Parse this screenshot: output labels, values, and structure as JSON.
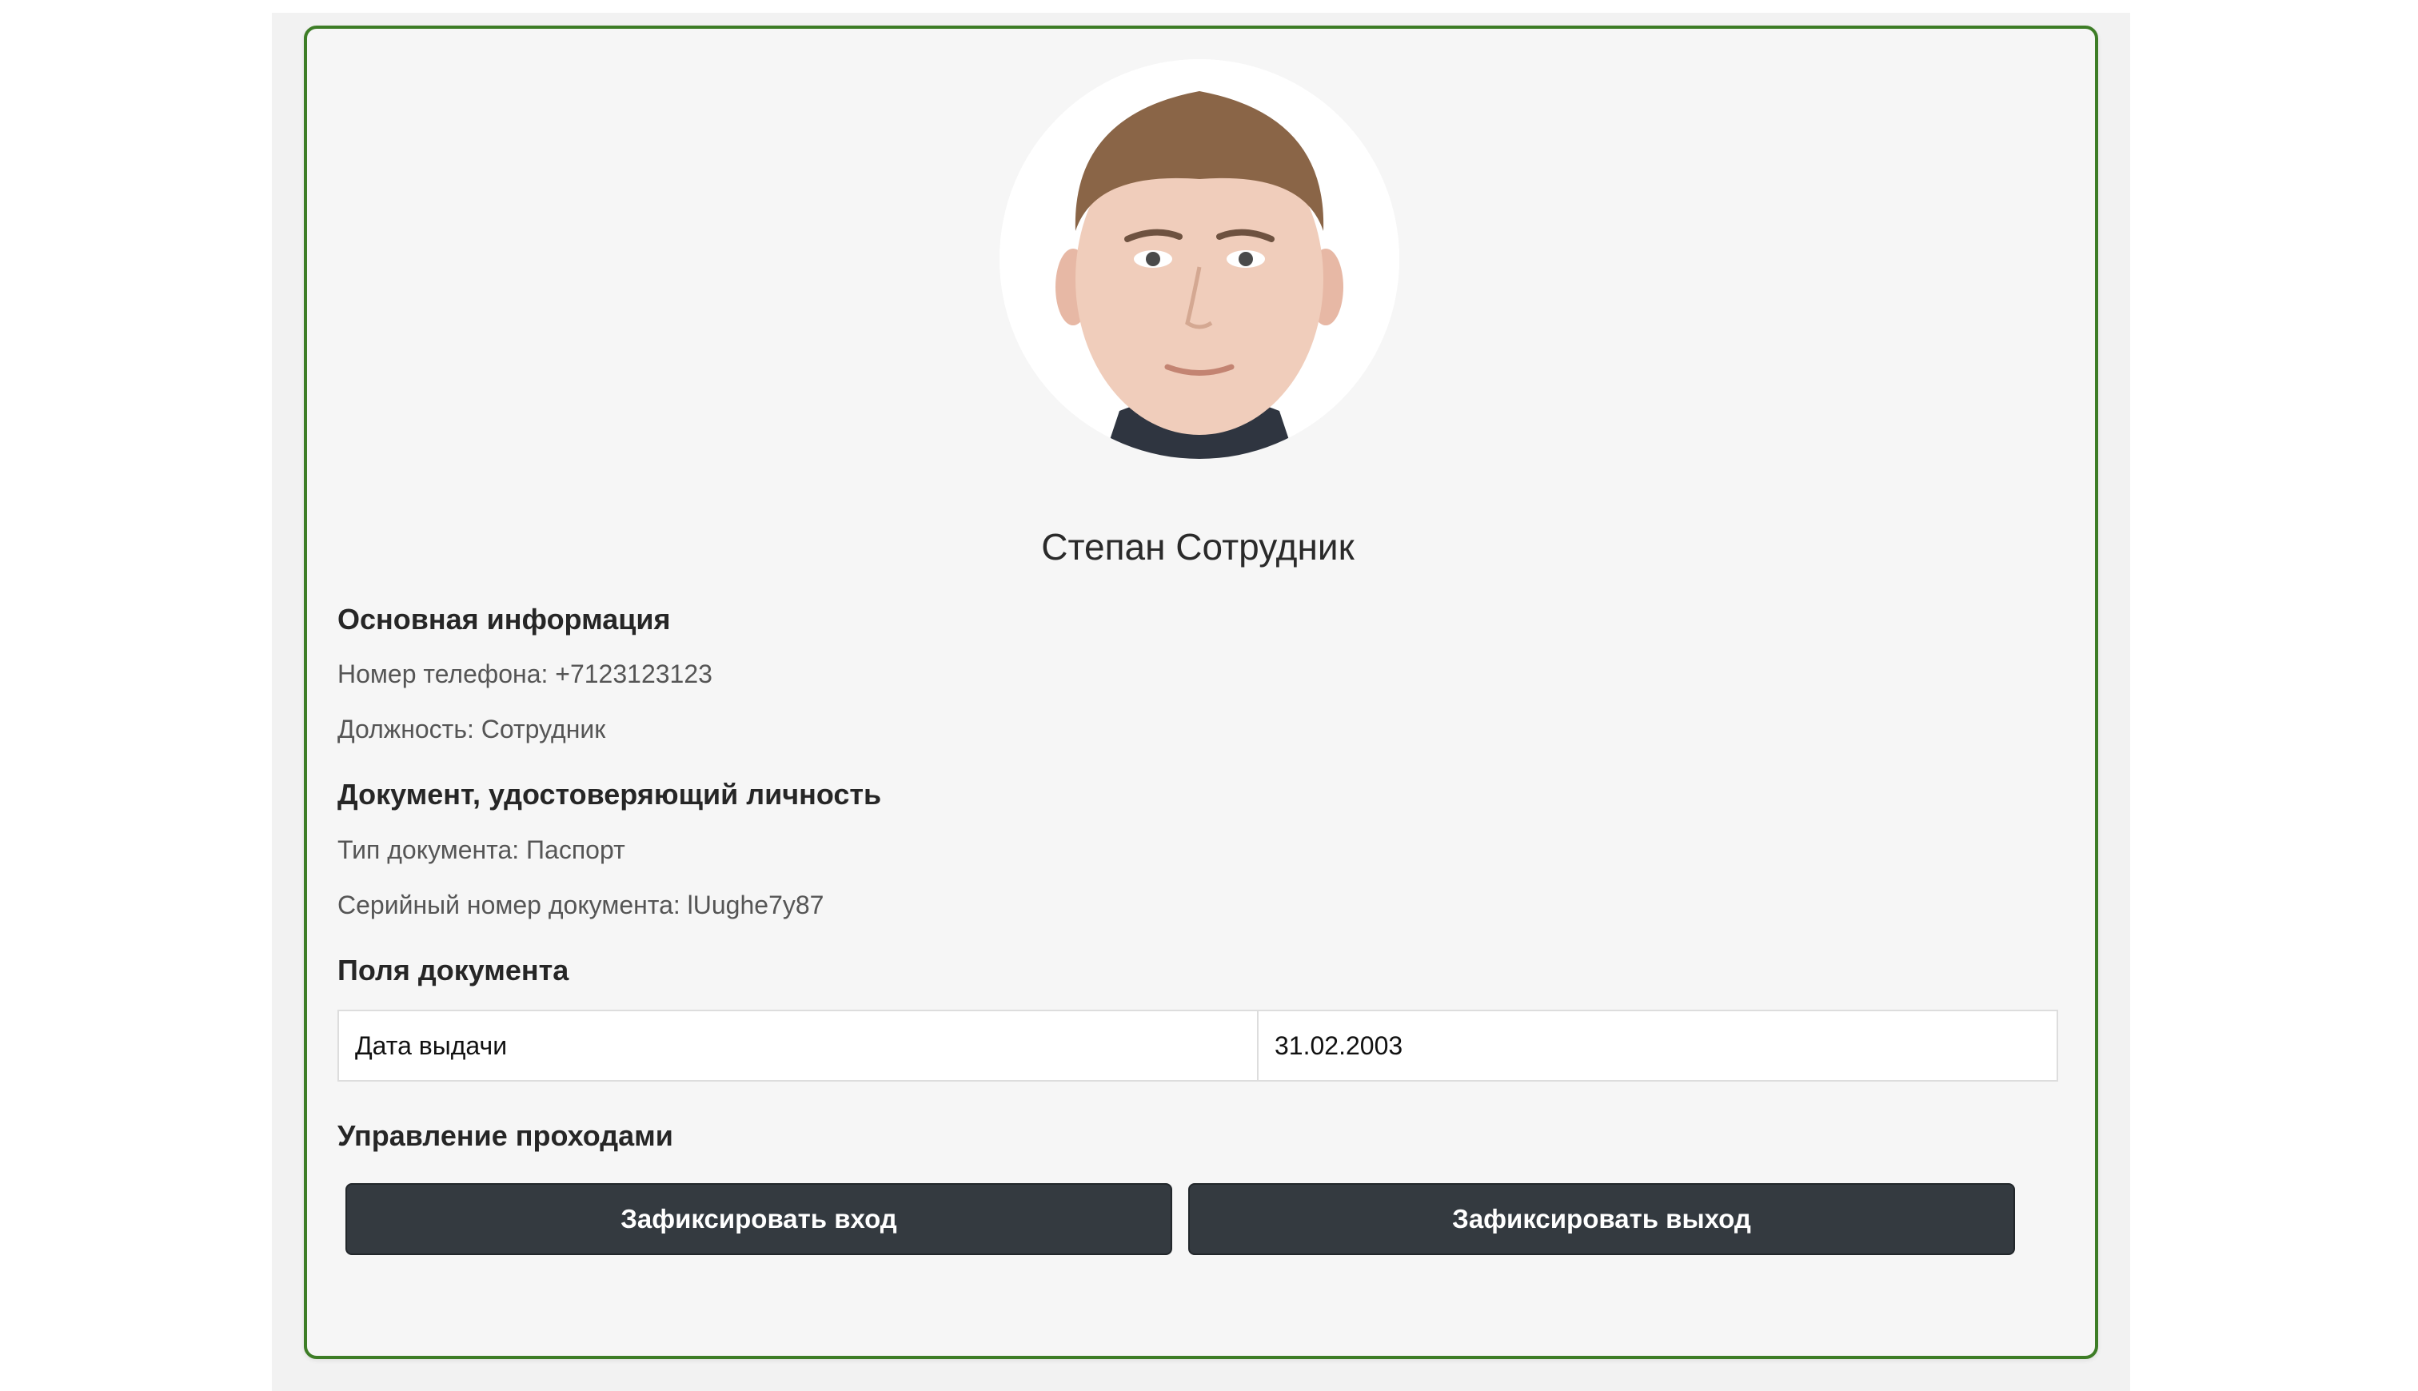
{
  "employee": {
    "name": "Степан Сотрудник"
  },
  "basic_info": {
    "title": "Основная информация",
    "phone": "Номер телефона: +7123123123",
    "position": "Должность: Сотрудник"
  },
  "identity_document": {
    "title": "Документ, удостоверяющий личность",
    "type": "Тип документа: Паспорт",
    "serial": "Серийный номер документа: lUughe7y87"
  },
  "document_fields": {
    "title": "Поля документа",
    "rows": [
      {
        "key": "Дата выдачи",
        "value": "31.02.2003"
      }
    ]
  },
  "access_control": {
    "title": "Управление проходами",
    "entry_button": "Зафиксировать вход",
    "exit_button": "Зафиксировать выход"
  },
  "colors": {
    "card_border": "#3d7d26",
    "button_bg": "#343a40"
  }
}
